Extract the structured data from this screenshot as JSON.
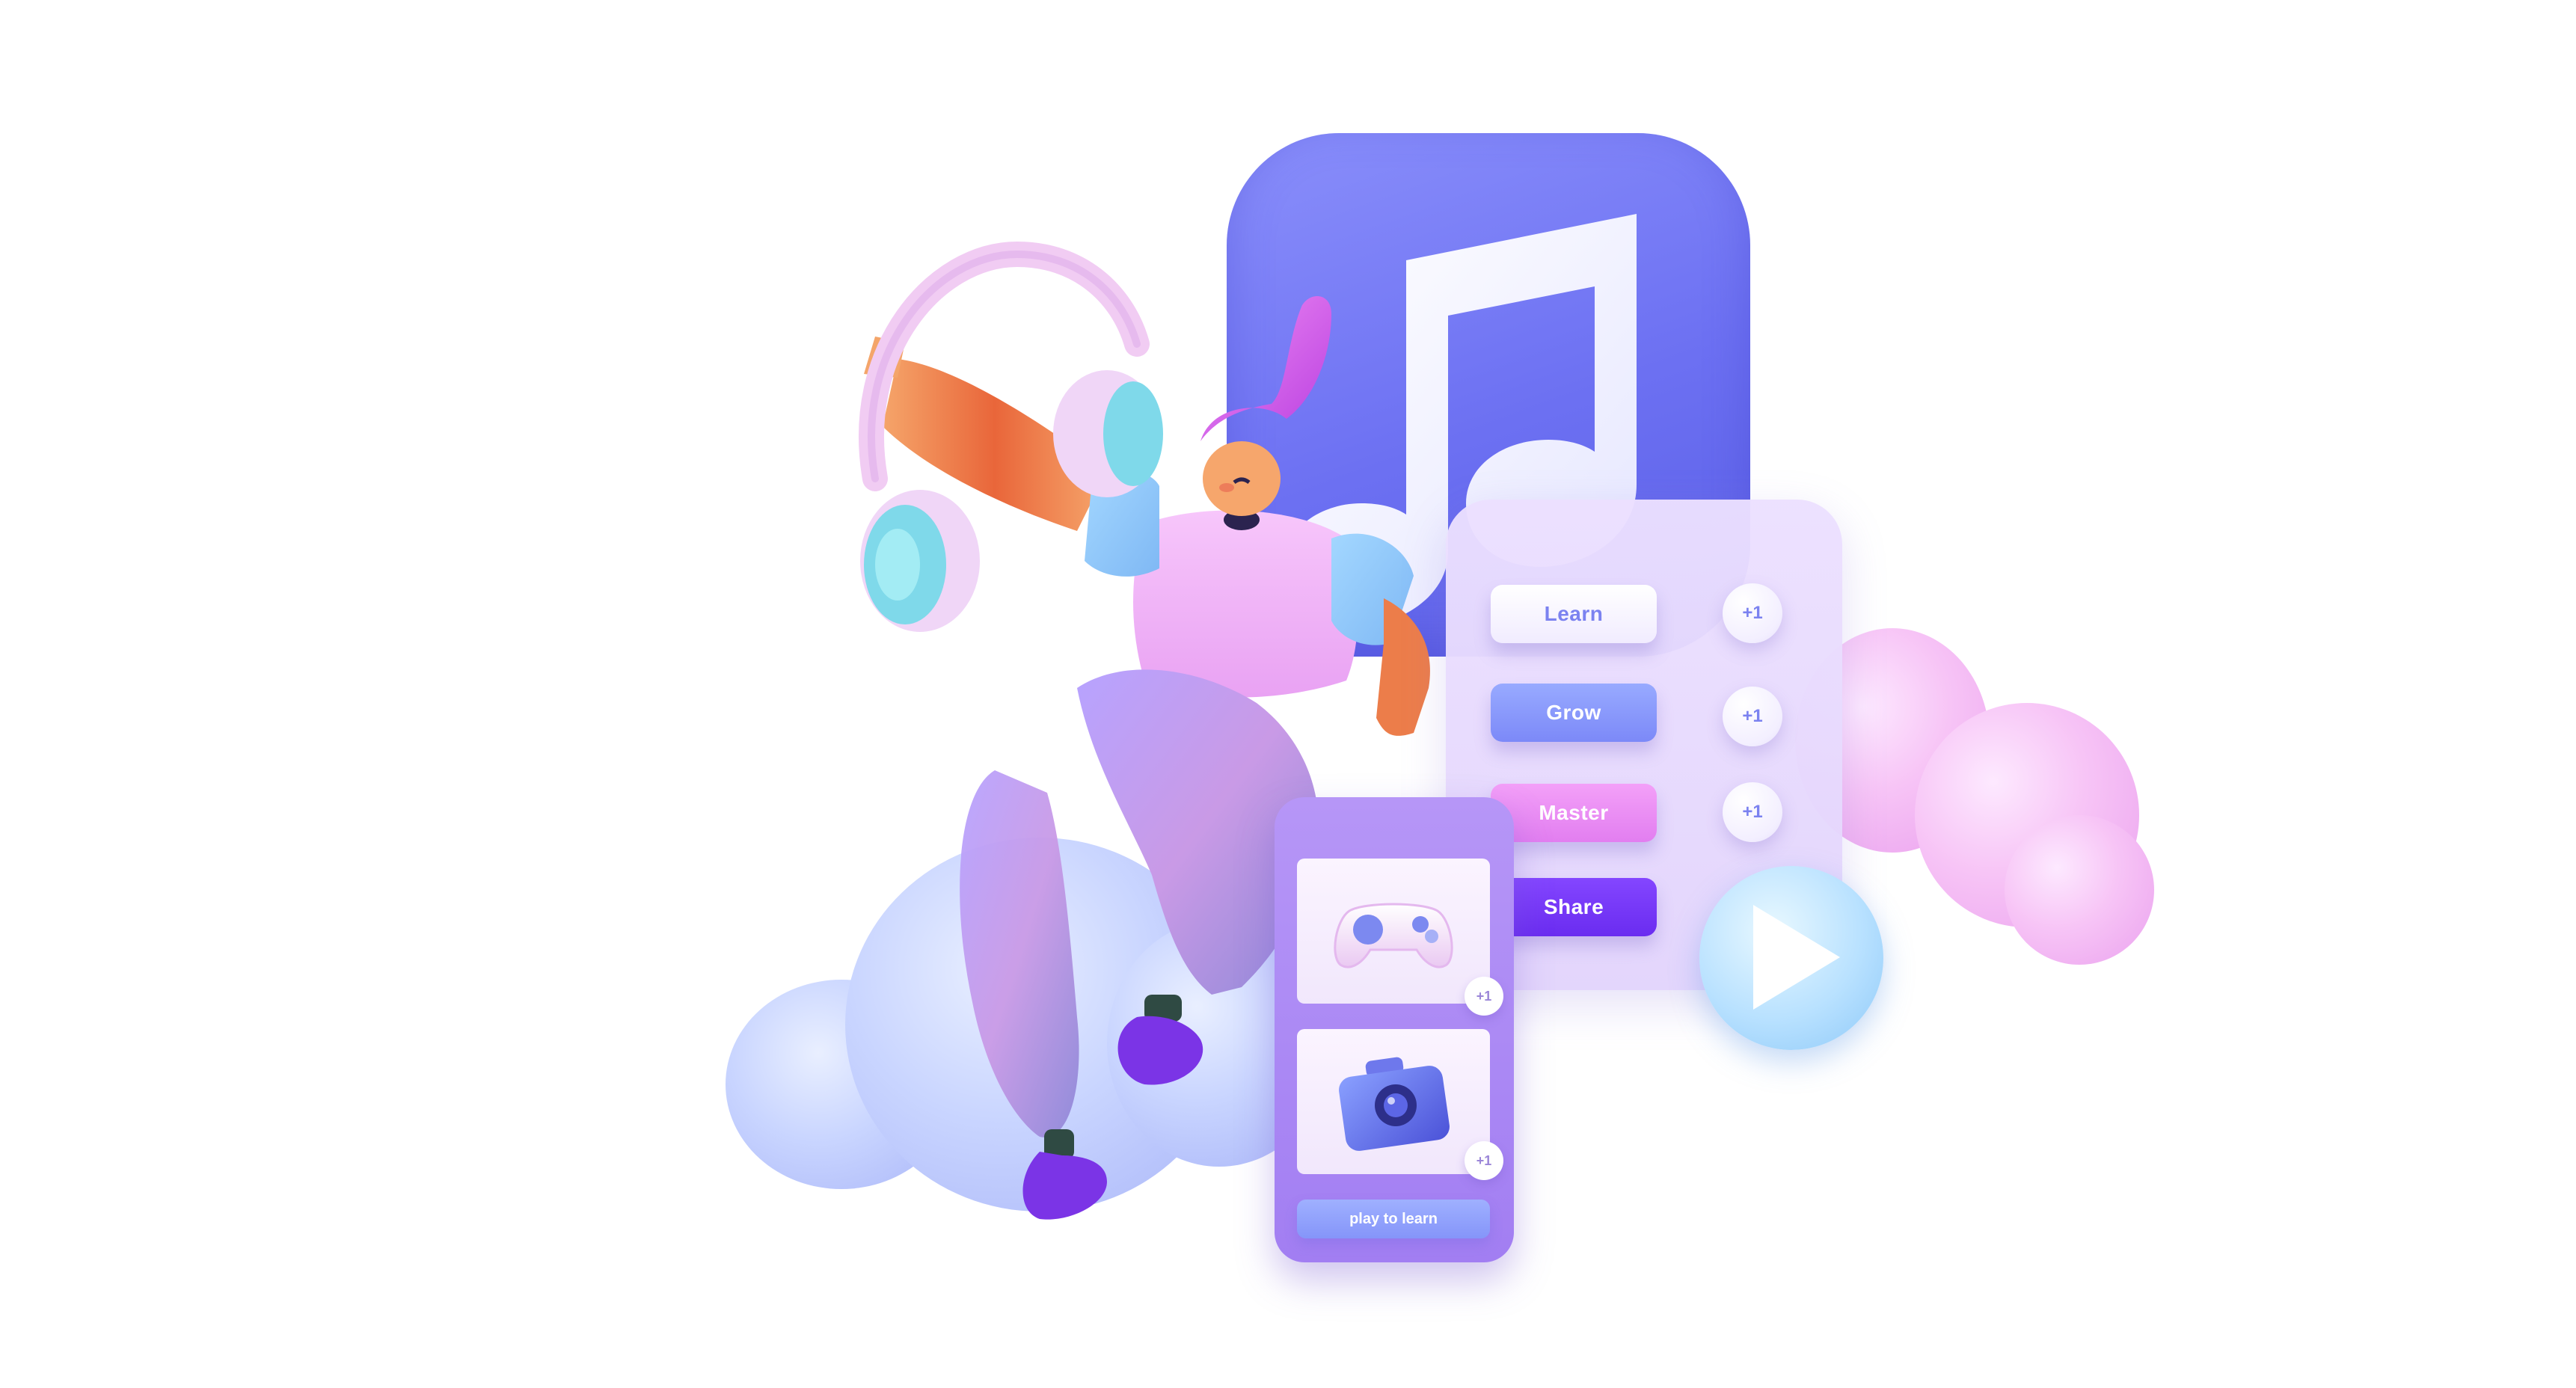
{
  "colors": {
    "music_icon": "#6c70f2",
    "learn_text": "#7b82f0",
    "grow": "#8a9cfb",
    "master": "#e98cf3",
    "share": "#7a3cf9",
    "phone": "#a98af4",
    "play": "#b8e1ff"
  },
  "icons": [
    "music-note-icon",
    "headphones-icon",
    "gamepad-icon",
    "camera-icon",
    "play-icon"
  ],
  "list": {
    "items": [
      {
        "label": "Learn",
        "badge": "+1"
      },
      {
        "label": "Grow",
        "badge": "+1"
      },
      {
        "label": "Master",
        "badge": "+1"
      },
      {
        "label": "Share"
      }
    ]
  },
  "phone": {
    "cards": [
      {
        "icon": "gamepad-icon",
        "badge": "+1"
      },
      {
        "icon": "camera-icon",
        "badge": "+1"
      }
    ],
    "button_label": "play to learn"
  }
}
